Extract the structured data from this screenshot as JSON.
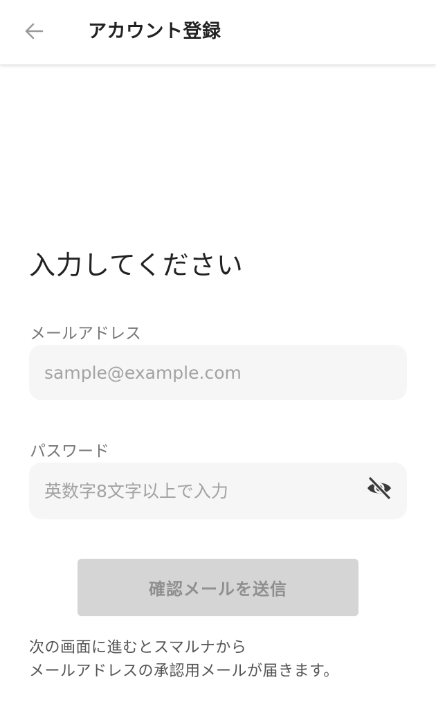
{
  "header": {
    "back_icon": "arrow-left-icon",
    "title": "アカウント登録"
  },
  "main": {
    "heading": "入力してください",
    "email": {
      "label": "メールアドレス",
      "placeholder": "sample@example.com",
      "value": ""
    },
    "password": {
      "label": "パスワード",
      "placeholder": "英数字8文字以上で入力",
      "value": "",
      "visibility_icon": "eye-off-icon"
    },
    "submit": {
      "label": "確認メールを送信",
      "enabled": false
    },
    "note_lines": [
      "次の画面に進むとスマルナから",
      "メールアドレスの承認用メールが届きます。"
    ]
  },
  "colors": {
    "input_background": "#f6f6f6",
    "button_disabled_background": "#d5d5d5",
    "button_disabled_text": "#8f8f8f",
    "label_text": "#777777",
    "placeholder_text": "#a2a2a2"
  }
}
